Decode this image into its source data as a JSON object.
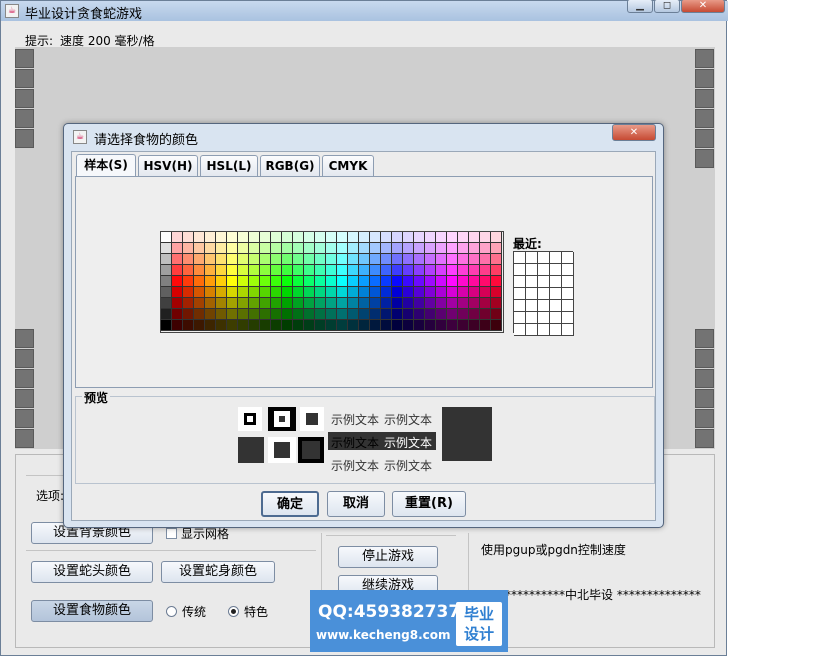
{
  "window": {
    "title": "毕业设计贪食蛇游戏",
    "minimize_glyph": "▁",
    "maximize_glyph": "◻",
    "close_glyph": "✕"
  },
  "hint": {
    "label": "提示:",
    "text": "速度 200 毫秒/格"
  },
  "options": {
    "label": "选项:",
    "bg_color_button": "设置背景颜色",
    "show_grid_label": "显示网格",
    "head_color_button": "设置蛇头颜色",
    "body_color_button": "设置蛇身颜色",
    "food_color_button": "设置食物颜色",
    "radio_traditional": "传统",
    "radio_special": "特色",
    "selected_radio": "特色"
  },
  "controls": {
    "stop_button": "停止游戏",
    "continue_button": "继续游戏",
    "speed_tip": "使用pgup或pgdn控制速度",
    "credit": "**************中北毕设 **************"
  },
  "watermark": {
    "qq_text": "QQ:459382737",
    "url_text": "www.kecheng8.com",
    "badge_line1": "毕业",
    "badge_line2": "设计"
  },
  "dialog": {
    "title": "请选择食物的颜色",
    "tabs": [
      {
        "label": "样本(S)",
        "selected": true
      },
      {
        "label": "HSV(H)",
        "selected": false
      },
      {
        "label": "HSL(L)",
        "selected": false
      },
      {
        "label": "RGB(G)",
        "selected": false
      },
      {
        "label": "CMYK",
        "selected": false
      }
    ],
    "recent_label": "最近:",
    "preview_label": "预览",
    "sample_text": "示例文本",
    "ok_button": "确定",
    "cancel_button": "取消",
    "reset_button": "重置(R)",
    "preview_color": "#333333"
  }
}
